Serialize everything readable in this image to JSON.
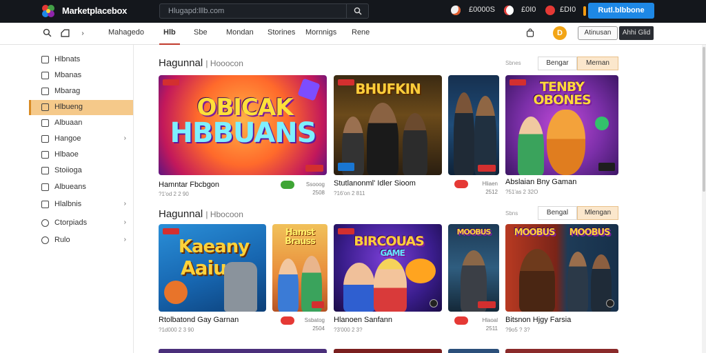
{
  "app": {
    "brand": "Marketplacebox"
  },
  "search": {
    "placeholder": "Hlugapd:lllb.com"
  },
  "top_stats": [
    {
      "icon": "fire-icon",
      "value": "£0000S"
    },
    {
      "icon": "bell-icon",
      "value": "£0I0"
    },
    {
      "icon": "gift-icon",
      "value": "£DI0"
    }
  ],
  "signin_label": "Rutl.blbbone",
  "nav": {
    "tabs": [
      "Mahagedo",
      "Hlb",
      "Sbe",
      "Mondan",
      "Storines",
      "Mornnigs",
      "Rene"
    ],
    "active_index": 1,
    "coin_label": "D",
    "account_label": "Atinusan",
    "dark_label": "Ahhi Glid"
  },
  "sidebar": {
    "items": [
      {
        "label": "Hlbnats",
        "chevron": false
      },
      {
        "label": "Mbanas",
        "chevron": false
      },
      {
        "label": "Mbarag",
        "chevron": false
      },
      {
        "label": "Hlbueng",
        "chevron": false
      },
      {
        "label": "Albuaan",
        "chevron": false
      },
      {
        "label": "Hangoe",
        "chevron": true
      },
      {
        "label": "Hlbaoe",
        "chevron": false
      },
      {
        "label": "Stoiioga",
        "chevron": false
      },
      {
        "label": "Albueans",
        "chevron": false
      },
      {
        "label": "Hlalbnis",
        "chevron": true
      },
      {
        "label": "Ctorpiads",
        "chevron": true
      },
      {
        "label": "Rulo",
        "chevron": true
      }
    ],
    "active_index": 3
  },
  "sections": [
    {
      "title": "Hagunnal",
      "subtitle": "Hooocon",
      "sort_label": "Sbnes",
      "sort_options": [
        "Bengar",
        "Mernan"
      ],
      "sort_active": 1,
      "cards": [
        {
          "art": "OBICAK HBBUANS",
          "title": "Hamntar Fbcbgon",
          "sub": "?1'od 2 2 90",
          "pill": "#3fa535",
          "price": "Ssooog\n2508"
        },
        {
          "art": "BHUFKIN",
          "title": "Stutlanonml' Idler Sioom",
          "sub": "?16'on 2 811",
          "pill": "#e53935",
          "price": "Hliaen\n2512"
        },
        {
          "art": "TENBY OBONES",
          "title": "Abslaian Bny Gaman",
          "sub": "?51'as 2 32O",
          "pill": "",
          "price": ""
        }
      ]
    },
    {
      "title": "Hagunnal",
      "subtitle": "Hbocoon",
      "sort_label": "Sbns",
      "sort_options": [
        "Bengal",
        "Mlengan"
      ],
      "sort_active": 1,
      "cards": [
        {
          "art": "Kaeany Aaiu",
          "title": "Rtolbatond Gay Garnan",
          "sub": "?1d000 2 3 90",
          "pill": "#e53935",
          "price": "Ssbatog\n2504"
        },
        {
          "art": "BIRCOUAS GAME",
          "title": "Hlanoen Sanfann",
          "sub": "?3'000 2 3?",
          "pill": "#e53935",
          "price": "Hlaoal\n2511"
        },
        {
          "art": "MOOBUS",
          "title": "Bitsnon Hjgy Farsia",
          "sub": "?9o5 ? 3?",
          "pill": "",
          "price": ""
        }
      ]
    }
  ],
  "colors": {
    "topbar": "#14171c",
    "accent": "#1e88e5",
    "active_tab": "#c0392b",
    "sidebar_active": "#f5c98a"
  }
}
